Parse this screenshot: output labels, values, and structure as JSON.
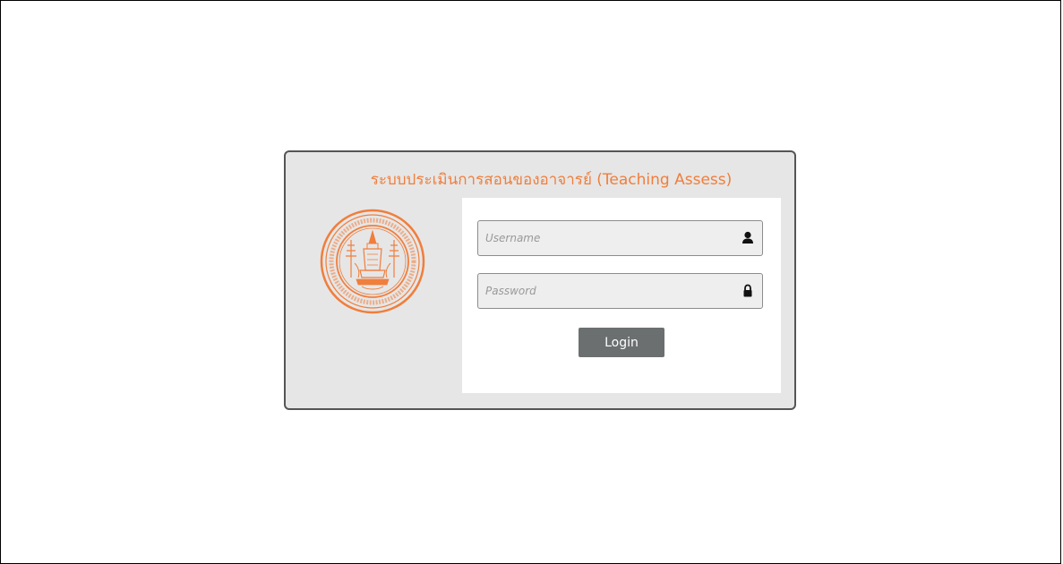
{
  "login": {
    "title": "ระบบประเมินการสอนของอาจารย์ (Teaching Assess)",
    "username_placeholder": "Username",
    "password_placeholder": "Password",
    "login_label": "Login"
  },
  "icons": {
    "username": "user-icon",
    "password": "lock-icon",
    "logo": "university-seal"
  },
  "colors": {
    "accent": "#f07e3c",
    "panel_bg": "#e6e6e6",
    "button_bg": "#6b6f70"
  }
}
